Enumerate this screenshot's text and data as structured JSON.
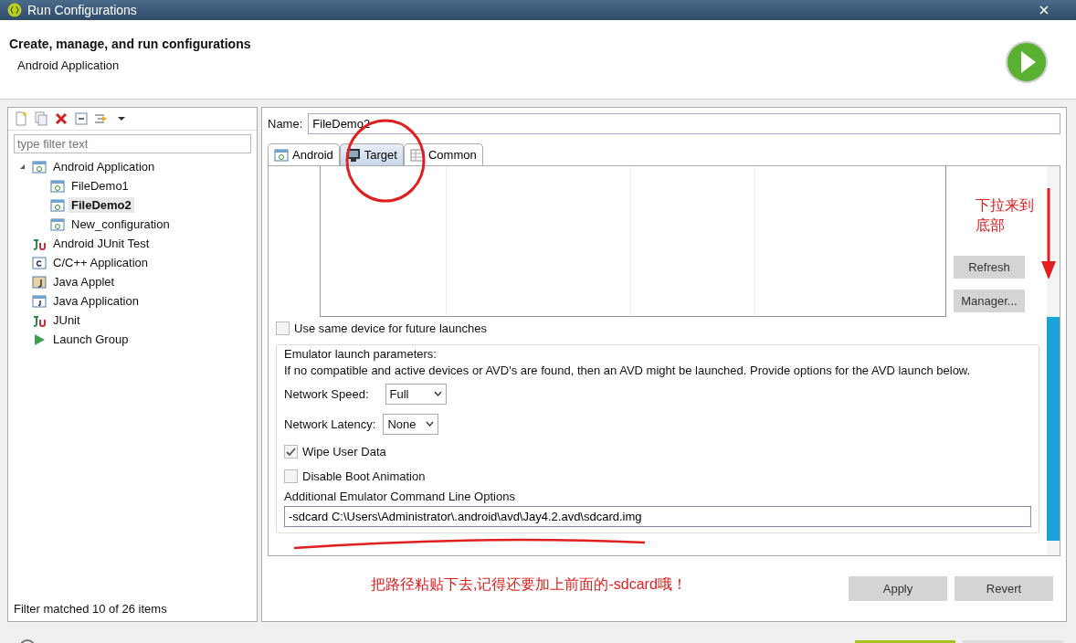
{
  "window": {
    "title": "Run Configurations"
  },
  "header": {
    "title": "Create, manage, and run configurations",
    "subtitle": "Android Application"
  },
  "sidebar": {
    "filter": {
      "placeholder": "type filter text"
    },
    "tree": [
      {
        "label": "Android Application",
        "kind": "android",
        "selected": false,
        "expanded": true,
        "children": [
          {
            "label": "FileDemo1",
            "kind": "android",
            "selected": false
          },
          {
            "label": "FileDemo2",
            "kind": "android",
            "selected": true
          },
          {
            "label": "New_configuration",
            "kind": "android",
            "selected": false
          }
        ]
      },
      {
        "label": "Android JUnit Test",
        "kind": "junit",
        "selected": false,
        "expanded": false
      },
      {
        "label": "C/C++ Application",
        "kind": "cpp",
        "selected": false,
        "expanded": false
      },
      {
        "label": "Java Applet",
        "kind": "applet",
        "selected": false,
        "expanded": false
      },
      {
        "label": "Java Application",
        "kind": "java",
        "selected": false,
        "expanded": false
      },
      {
        "label": "JUnit",
        "kind": "junit",
        "selected": false,
        "expanded": false
      },
      {
        "label": "Launch Group",
        "kind": "launch",
        "selected": false,
        "expanded": false
      }
    ],
    "status": "Filter matched 10 of 26 items"
  },
  "main": {
    "name_label": "Name:",
    "name_value": "FileDemo2",
    "tabs": [
      {
        "label": "Android",
        "kind": "android",
        "selected": false
      },
      {
        "label": "Target",
        "kind": "monitor",
        "selected": true
      },
      {
        "label": "Common",
        "kind": "table",
        "selected": false
      }
    ],
    "device_buttons": [
      "Refresh",
      "Manager..."
    ],
    "same_device": {
      "label": "Use same device for future launches",
      "checked": false
    },
    "emulator": {
      "title": "Emulator launch parameters:",
      "note": "If no compatible and active devices or AVD's are found, then an AVD might be launched. Provide options for the AVD launch below.",
      "network_speed": {
        "label": "Network Speed:",
        "value": "Full"
      },
      "network_latency": {
        "label": "Network Latency:",
        "value": "None"
      },
      "options": [
        {
          "label": "Wipe User Data",
          "checked": true
        },
        {
          "label": "Disable Boot Animation",
          "checked": false
        }
      ],
      "command_label": "Additional Emulator Command Line Options",
      "command_value": "-sdcard C:\\Users\\Administrator\\.android\\avd\\Jay4.2.avd\\sdcard.img"
    },
    "buttons": [
      "Apply",
      "Revert"
    ]
  },
  "annotations": {
    "scroll_note": "下拉来到底部",
    "paste_note": "把路径粘贴下去,记得还要加上前面的-sdcard哦！"
  }
}
